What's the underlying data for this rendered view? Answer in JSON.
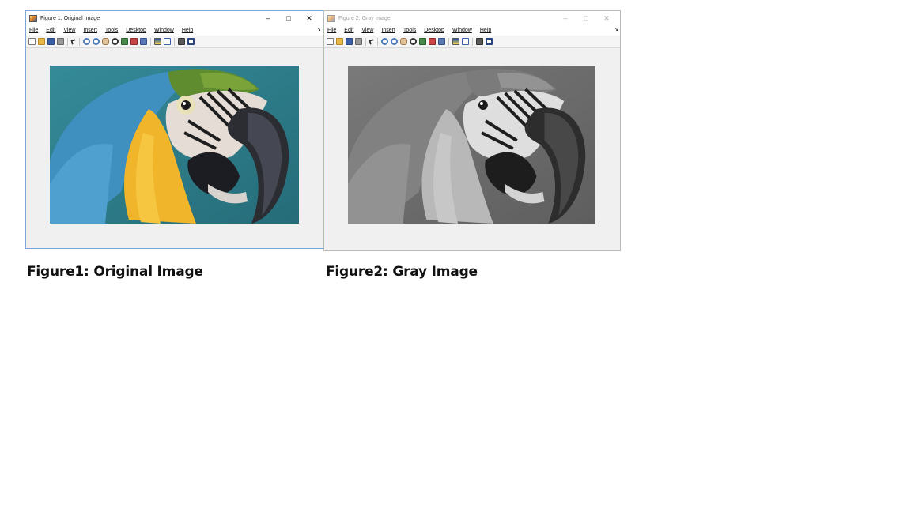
{
  "windows": [
    {
      "title": "Figure 1: Original Image",
      "menu": [
        "File",
        "Edit",
        "View",
        "Insert",
        "Tools",
        "Desktop",
        "Window",
        "Help"
      ],
      "caption_buttons": {
        "minimize": "–",
        "maximize": "□",
        "close": "✕"
      },
      "menu_overflow": "↘",
      "image_mode": "color"
    },
    {
      "title": "Figure 2: Gray image",
      "menu": [
        "File",
        "Edit",
        "View",
        "Insert",
        "Tools",
        "Desktop",
        "Window",
        "Help"
      ],
      "caption_buttons": {
        "minimize": "–",
        "maximize": "□",
        "close": "✕"
      },
      "menu_overflow": "↘",
      "image_mode": "grayscale"
    }
  ],
  "toolbar_icons": [
    "new-figure-icon",
    "open-icon",
    "save-icon",
    "print-icon",
    "select-arrow-icon",
    "zoom-in-icon",
    "zoom-out-icon",
    "pan-icon",
    "rotate-3d-icon",
    "data-cursor-icon",
    "brush-icon",
    "link-plot-icon",
    "insert-colorbar-icon",
    "insert-legend-icon",
    "hide-plot-tools-icon",
    "show-plot-tools-icon"
  ],
  "captions": {
    "figure1": "Figure1: Original Image",
    "figure2": "Figure2: Gray Image"
  },
  "colors": {
    "background_teal": "#2f7f8c",
    "feather_yellow": "#f0b52a",
    "feather_green": "#5e8c2e",
    "feather_blue": "#3f8fbf",
    "face_white": "#e6dcd6",
    "beak_dark": "#2b2d33"
  }
}
